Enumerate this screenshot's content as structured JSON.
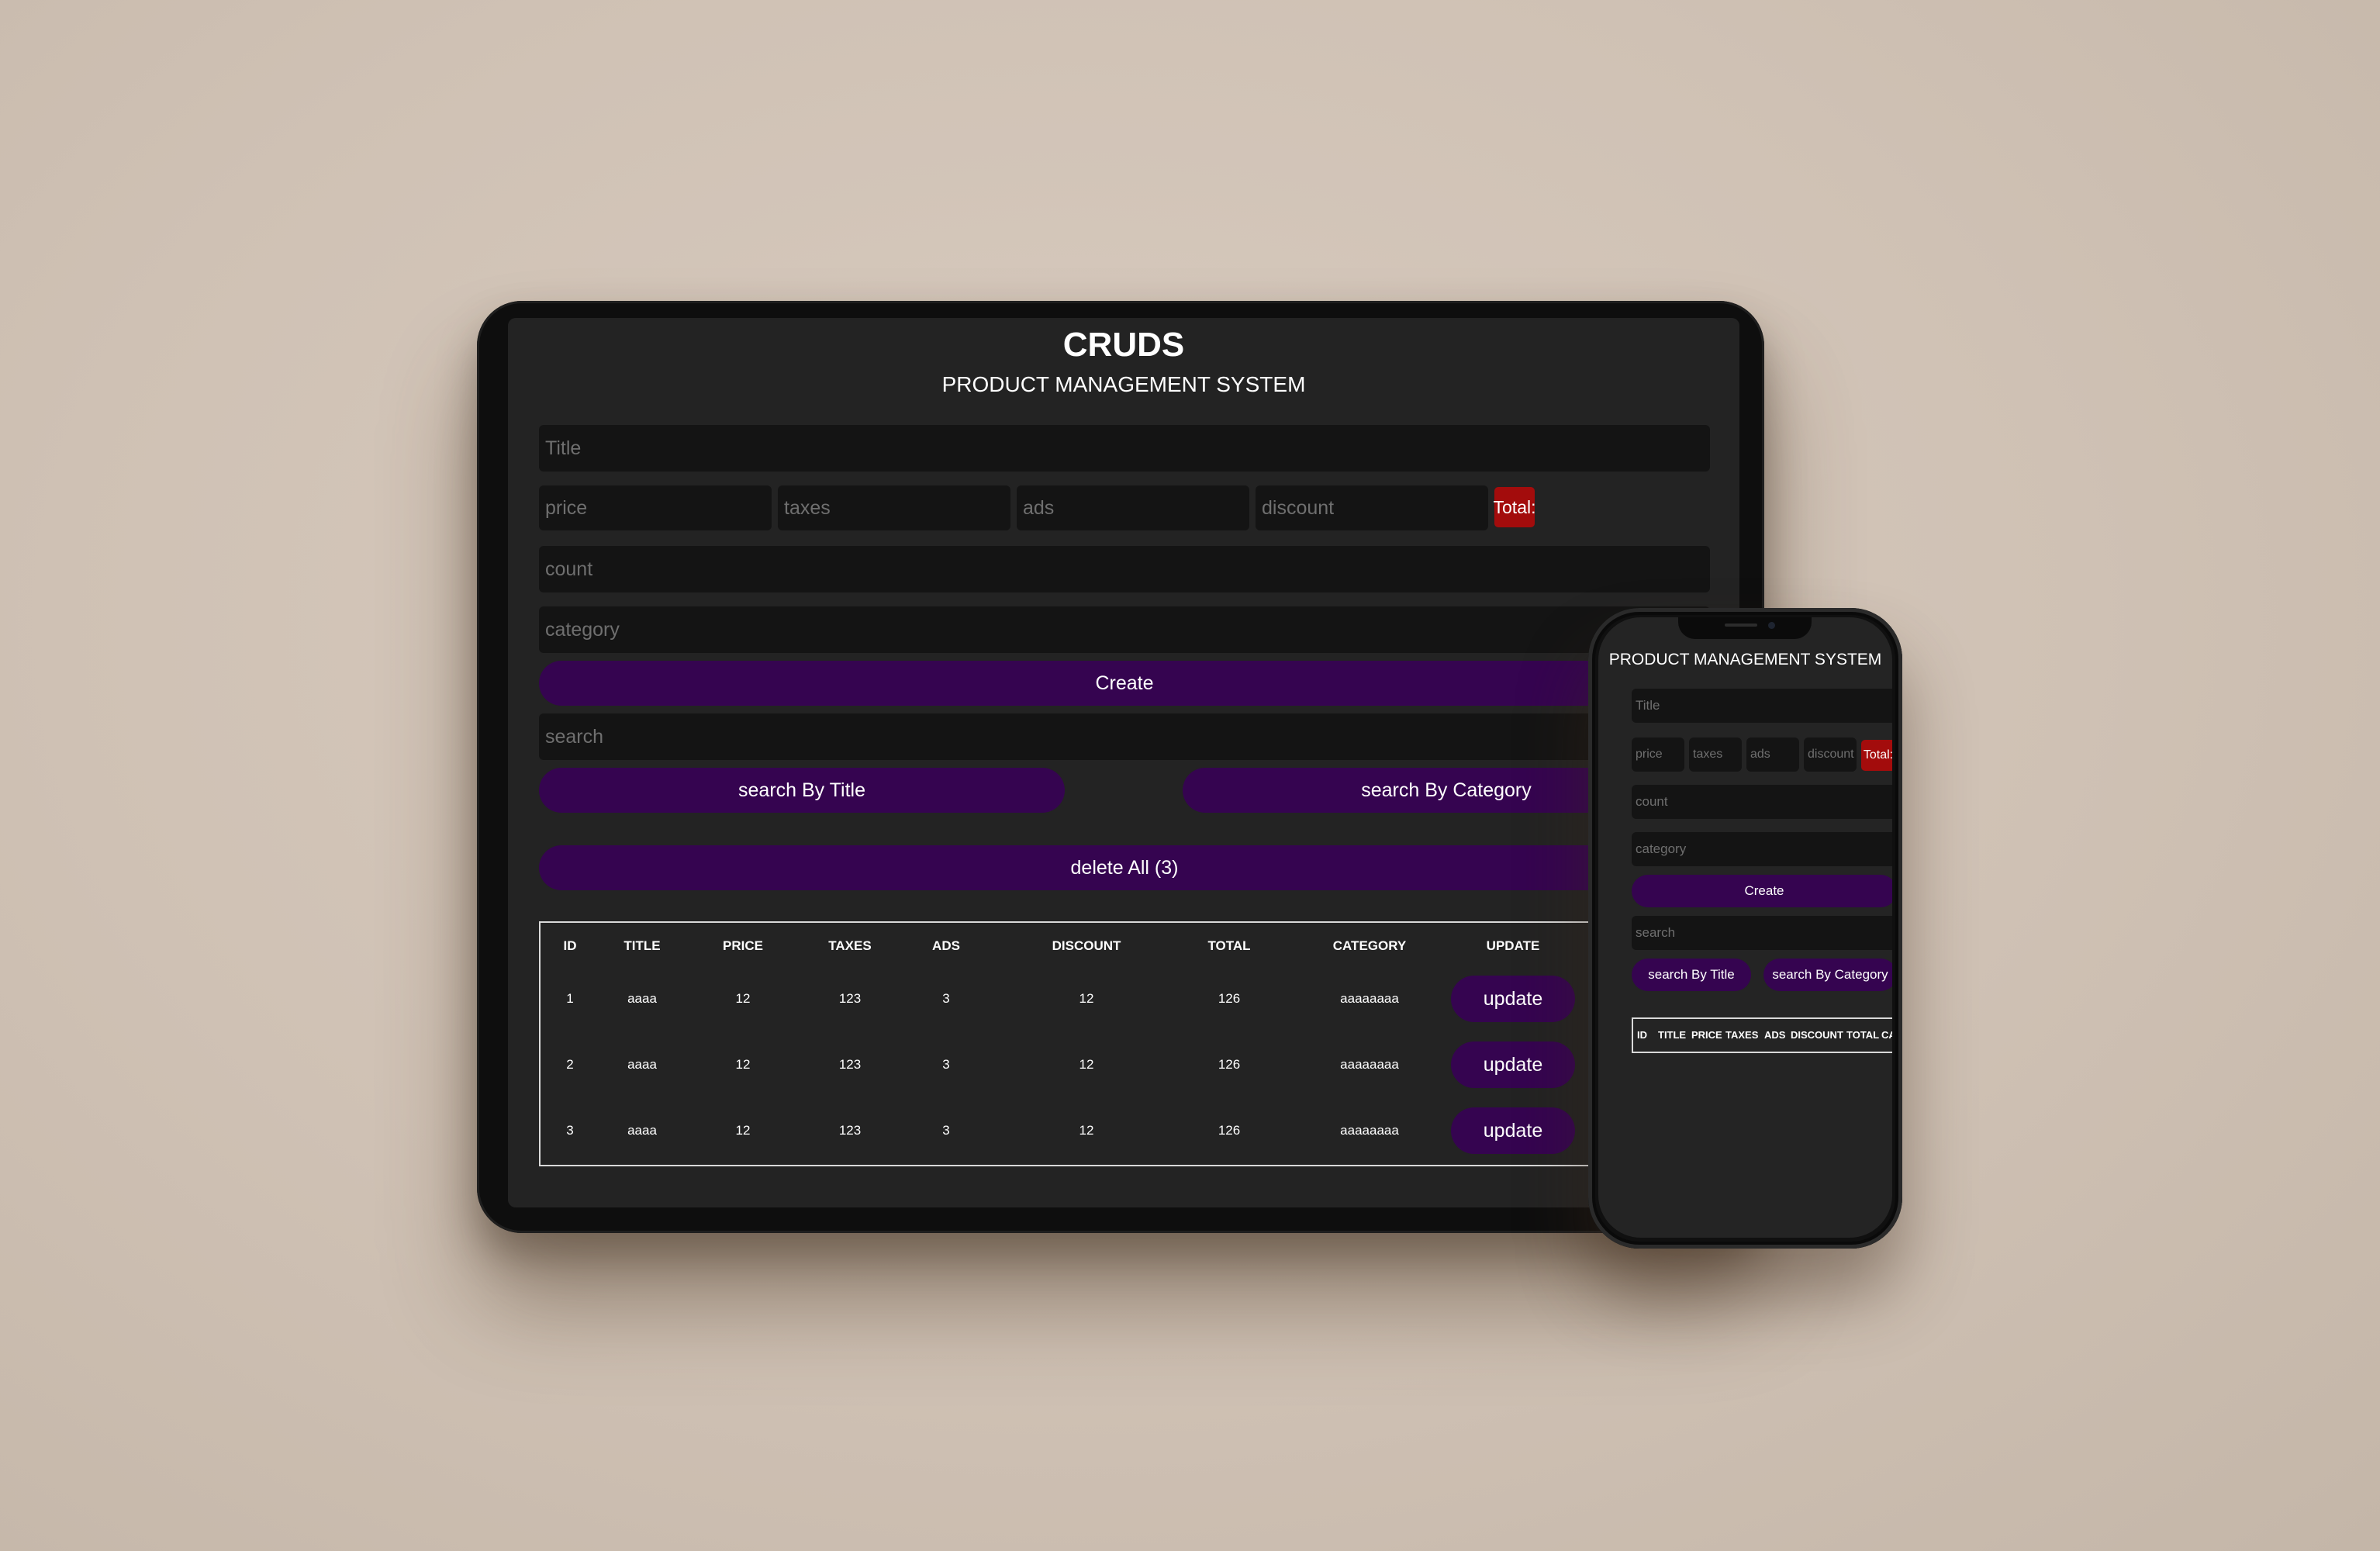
{
  "app": {
    "title": "CRUDS",
    "subtitle": "PRODUCT MANAGEMENT SYSTEM"
  },
  "form": {
    "title_placeholder": "Title",
    "price_placeholder": "price",
    "taxes_placeholder": "taxes",
    "ads_placeholder": "ads",
    "discount_placeholder": "discount",
    "total_label": "Total:",
    "count_placeholder": "count",
    "category_placeholder": "category",
    "create_label": "Create"
  },
  "search": {
    "placeholder": "search",
    "by_title_label": "search By Title",
    "by_category_label": "search By Category"
  },
  "delete_all_label": "delete All (3)",
  "table": {
    "headers": [
      "ID",
      "TITLE",
      "PRICE",
      "TAXES",
      "ADS",
      "DISCOUNT",
      "TOTAL",
      "CATEGORY",
      "UPDATE"
    ],
    "phone_headers": [
      "ID",
      "TITLE",
      "PRICE",
      "TAXES",
      "ADS",
      "DISCOUNT",
      "TOTAL",
      "CATE"
    ],
    "update_label": "update",
    "rows": [
      {
        "id": "1",
        "title": "aaaa",
        "price": "12",
        "taxes": "123",
        "ads": "3",
        "discount": "12",
        "total": "126",
        "category": "aaaaaaaa"
      },
      {
        "id": "2",
        "title": "aaaa",
        "price": "12",
        "taxes": "123",
        "ads": "3",
        "discount": "12",
        "total": "126",
        "category": "aaaaaaaa"
      },
      {
        "id": "3",
        "title": "aaaa",
        "price": "12",
        "taxes": "123",
        "ads": "3",
        "discount": "12",
        "total": "126",
        "category": "aaaaaaaa"
      }
    ]
  },
  "colors": {
    "background": "#cfc1b4",
    "screen": "#232323",
    "input": "#141414",
    "button": "#350450",
    "total_badge": "#a30c0c"
  }
}
